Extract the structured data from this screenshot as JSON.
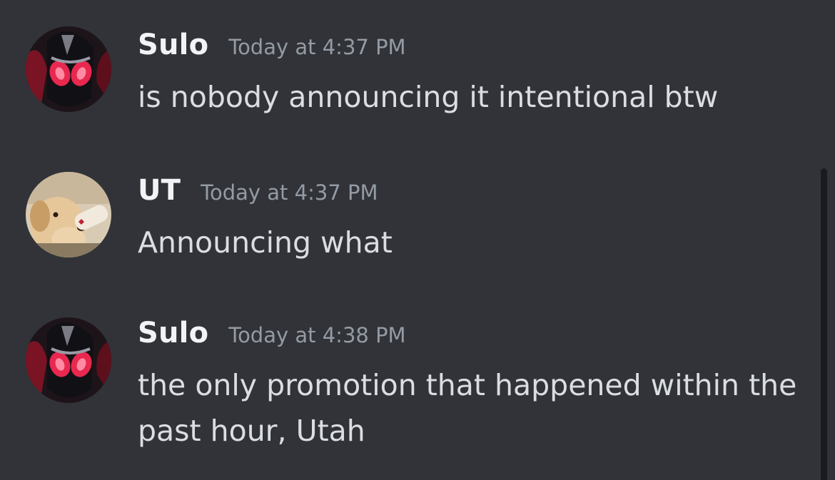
{
  "messages": [
    {
      "username": "Sulo",
      "timestamp": "Today at 4:37 PM",
      "text": "is nobody announcing it intentional btw",
      "avatar": "hooded-character-avatar"
    },
    {
      "username": "UT",
      "timestamp": "Today at 4:37 PM",
      "text": "Announcing what",
      "avatar": "dog-photo-avatar"
    },
    {
      "username": "Sulo",
      "timestamp": "Today at 4:38 PM",
      "text": "the only promotion that happened within the\npast hour, Utah",
      "avatar": "hooded-character-avatar"
    }
  ],
  "colors": {
    "background": "#313338",
    "username": "#f2f3f5",
    "timestamp": "#949ba4",
    "message_text": "#dbdee1",
    "scrollbar": "#1a1b1e"
  }
}
